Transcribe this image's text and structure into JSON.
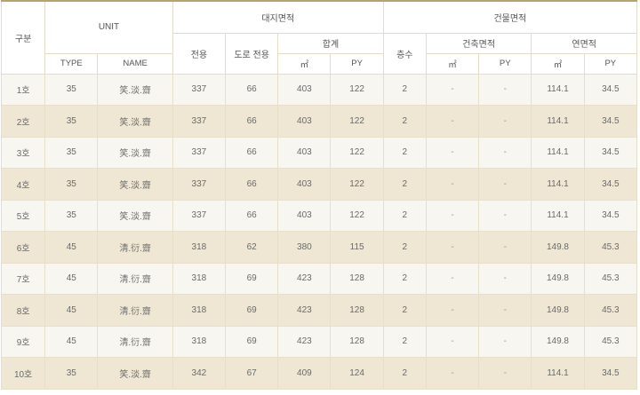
{
  "header": {
    "gubun": "구분",
    "unit": "UNIT",
    "type": "TYPE",
    "name": "NAME",
    "land_area": "대지면적",
    "exclusive": "전용",
    "road_exclusive": "도로 전용",
    "total": "합계",
    "sqm": "㎡",
    "py": "PY",
    "building_area": "건물면적",
    "floors": "층수",
    "building_footprint": "건축면적",
    "floor_area": "연면적"
  },
  "rows": [
    {
      "unit": "1호",
      "type": "35",
      "name": "笑.淡.齋",
      "exclusive": "337",
      "road": "66",
      "total_sqm": "403",
      "total_py": "122",
      "floors": "2",
      "bld_sqm": "-",
      "bld_py": "-",
      "floor_sqm": "114.1",
      "floor_py": "34.5"
    },
    {
      "unit": "2호",
      "type": "35",
      "name": "笑.淡.齋",
      "exclusive": "337",
      "road": "66",
      "total_sqm": "403",
      "total_py": "122",
      "floors": "2",
      "bld_sqm": "-",
      "bld_py": "-",
      "floor_sqm": "114.1",
      "floor_py": "34.5"
    },
    {
      "unit": "3호",
      "type": "35",
      "name": "笑.淡.齋",
      "exclusive": "337",
      "road": "66",
      "total_sqm": "403",
      "total_py": "122",
      "floors": "2",
      "bld_sqm": "-",
      "bld_py": "-",
      "floor_sqm": "114.1",
      "floor_py": "34.5"
    },
    {
      "unit": "4호",
      "type": "35",
      "name": "笑.淡.齋",
      "exclusive": "337",
      "road": "66",
      "total_sqm": "403",
      "total_py": "122",
      "floors": "2",
      "bld_sqm": "-",
      "bld_py": "-",
      "floor_sqm": "114.1",
      "floor_py": "34.5"
    },
    {
      "unit": "5호",
      "type": "35",
      "name": "笑.淡.齋",
      "exclusive": "337",
      "road": "66",
      "total_sqm": "403",
      "total_py": "122",
      "floors": "2",
      "bld_sqm": "-",
      "bld_py": "-",
      "floor_sqm": "114.1",
      "floor_py": "34.5"
    },
    {
      "unit": "6호",
      "type": "45",
      "name": "淸.衍.齋",
      "exclusive": "318",
      "road": "62",
      "total_sqm": "380",
      "total_py": "115",
      "floors": "2",
      "bld_sqm": "-",
      "bld_py": "-",
      "floor_sqm": "149.8",
      "floor_py": "45.3"
    },
    {
      "unit": "7호",
      "type": "45",
      "name": "淸.衍.齋",
      "exclusive": "318",
      "road": "69",
      "total_sqm": "423",
      "total_py": "128",
      "floors": "2",
      "bld_sqm": "-",
      "bld_py": "-",
      "floor_sqm": "149.8",
      "floor_py": "45.3"
    },
    {
      "unit": "8호",
      "type": "45",
      "name": "淸.衍.齋",
      "exclusive": "318",
      "road": "69",
      "total_sqm": "423",
      "total_py": "128",
      "floors": "2",
      "bld_sqm": "-",
      "bld_py": "-",
      "floor_sqm": "149.8",
      "floor_py": "45.3"
    },
    {
      "unit": "9호",
      "type": "45",
      "name": "淸.衍.齋",
      "exclusive": "318",
      "road": "69",
      "total_sqm": "423",
      "total_py": "128",
      "floors": "2",
      "bld_sqm": "-",
      "bld_py": "-",
      "floor_sqm": "149.8",
      "floor_py": "45.3"
    },
    {
      "unit": "10호",
      "type": "35",
      "name": "笑.淡.齋",
      "exclusive": "342",
      "road": "67",
      "total_sqm": "409",
      "total_py": "124",
      "floors": "2",
      "bld_sqm": "-",
      "bld_py": "-",
      "floor_sqm": "114.1",
      "floor_py": "34.5"
    }
  ],
  "colors": {
    "accent_line": "#b8a46a",
    "row_light": "#f8f6f1",
    "row_dark": "#efe7d3",
    "border": "#e3dcc6"
  }
}
